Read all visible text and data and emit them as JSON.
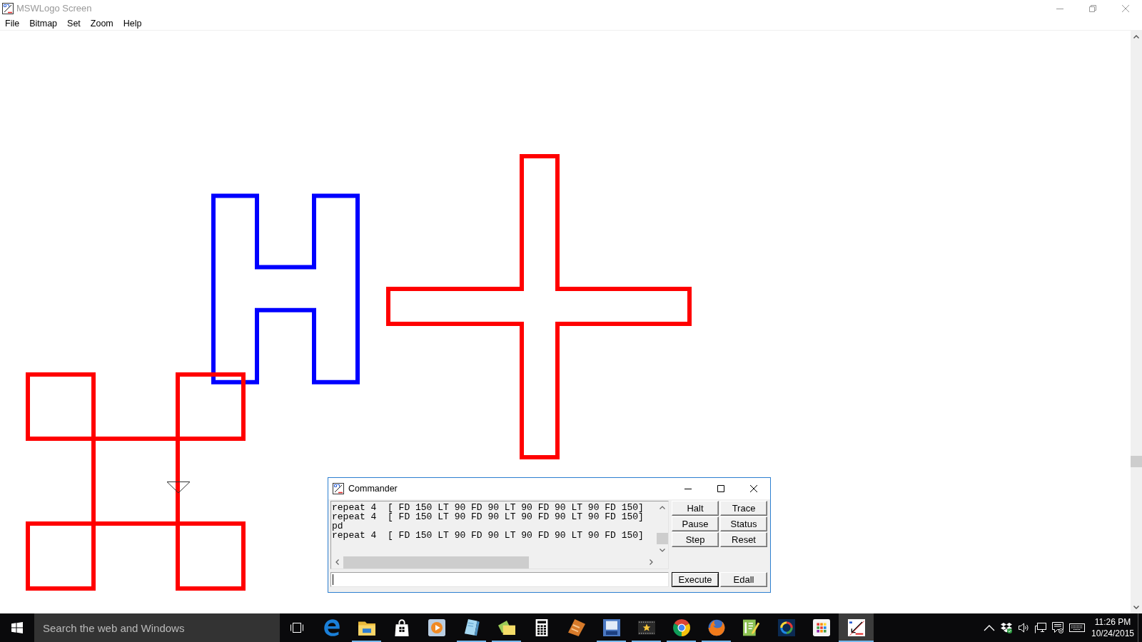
{
  "window": {
    "title": "MSWLogo Screen"
  },
  "menu": [
    "File",
    "Bitmap",
    "Set",
    "Zoom",
    "Help"
  ],
  "canvas": {
    "shapes": [
      {
        "kind": "h",
        "color": "#0000ff"
      },
      {
        "kind": "cross",
        "color": "#ff0000"
      },
      {
        "kind": "grid",
        "color": "#ff0000"
      }
    ]
  },
  "commander": {
    "title": "Commander",
    "history": [
      "repeat 4  [ FD 150 LT 90 FD 90 LT 90 FD 90 LT 90 FD 150]",
      "repeat 4  [ FD 150 LT 90 FD 90 LT 90 FD 90 LT 90 FD 150]",
      "pd",
      "repeat 4  [ FD 150 LT 90 FD 90 LT 90 FD 90 LT 90 FD 150]"
    ],
    "control_buttons": [
      "Halt",
      "Trace",
      "Pause",
      "Status",
      "Step",
      "Reset"
    ],
    "action_buttons": [
      {
        "label": "Execute",
        "default": true
      },
      {
        "label": "Edall",
        "default": false
      }
    ]
  },
  "taskbar": {
    "search": {
      "placeholder": "Search the web and Windows"
    },
    "apps": [
      {
        "kind": "edge",
        "running": false,
        "active": false
      },
      {
        "kind": "explorer",
        "running": true,
        "active": false
      },
      {
        "kind": "store",
        "running": false,
        "active": false
      },
      {
        "kind": "media",
        "running": false,
        "active": false
      },
      {
        "kind": "book",
        "running": true,
        "active": false
      },
      {
        "kind": "folders",
        "running": true,
        "active": false
      },
      {
        "kind": "calculator",
        "running": false,
        "active": false
      },
      {
        "kind": "film",
        "running": false,
        "active": false
      },
      {
        "kind": "frame",
        "running": true,
        "active": false
      },
      {
        "kind": "star",
        "running": true,
        "active": false
      },
      {
        "kind": "chrome",
        "running": true,
        "active": false
      },
      {
        "kind": "firefox",
        "running": true,
        "active": false
      },
      {
        "kind": "pendoc",
        "running": false,
        "active": false
      },
      {
        "kind": "ring",
        "running": false,
        "active": false
      },
      {
        "kind": "dots",
        "running": false,
        "active": false
      },
      {
        "kind": "logo",
        "running": true,
        "active": true
      }
    ],
    "clock": {
      "time": "11:26 PM",
      "date": "10/24/2015"
    }
  }
}
